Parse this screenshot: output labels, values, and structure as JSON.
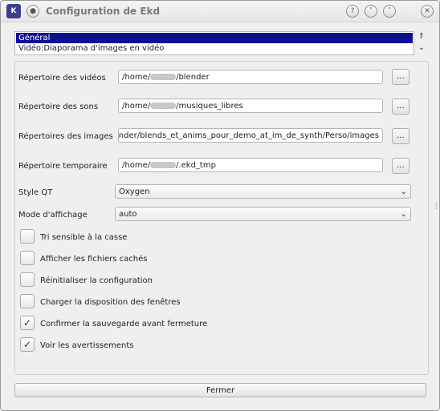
{
  "window": {
    "title": "Configuration de Ekd",
    "app_icon_text": "K",
    "pin_glyph": "●",
    "help_glyph": "?",
    "minimize_glyph": "˅",
    "maximize_glyph": "˄",
    "close_glyph": "✕"
  },
  "categories": {
    "items": [
      {
        "label": "Général",
        "selected": true
      },
      {
        "label": "Vidéo:Diaporama d'images en vidéo",
        "selected": false
      }
    ],
    "scroll_up_glyph": "⇑",
    "scroll_down_glyph": "⌄"
  },
  "paths": {
    "videos": {
      "label": "Répertoire des vidéos",
      "prefix": "/home/",
      "suffix": "/blender",
      "browse": "..."
    },
    "sons": {
      "label": "Répertoire des sons",
      "prefix": "/home/",
      "suffix": "/musiques_libres",
      "browse": "..."
    },
    "images": {
      "label": "Répertoires des images",
      "value": "blender/blends_et_anims_pour_demo_at_im_de_synth/Perso/images",
      "browse": "..."
    },
    "temp": {
      "label": "Répertoire temporaire",
      "prefix": "/home/",
      "suffix": "/.ekd_tmp",
      "browse": "..."
    }
  },
  "combos": {
    "style_qt": {
      "label": "Style QT",
      "value": "Oxygen",
      "arrow": "⌄"
    },
    "mode": {
      "label": "Mode d'affichage",
      "value": "auto",
      "arrow": "⌄"
    }
  },
  "checkboxes": [
    {
      "label": "Tri sensible à la casse",
      "checked": false,
      "mark": ""
    },
    {
      "label": "Afficher les fichiers cachés",
      "checked": false,
      "mark": ""
    },
    {
      "label": "Réinitialiser la configuration",
      "checked": false,
      "mark": ""
    },
    {
      "label": "Charger la disposition des fenêtres",
      "checked": false,
      "mark": ""
    },
    {
      "label": "Confirmer la sauvegarde avant fermeture",
      "checked": true,
      "mark": "✓"
    },
    {
      "label": "Voir les avertissements",
      "checked": true,
      "mark": "✓"
    }
  ],
  "footer": {
    "close_label": "Fermer"
  },
  "colors": {
    "selection": "#0f0f8f",
    "window_bg": "#efefef"
  }
}
